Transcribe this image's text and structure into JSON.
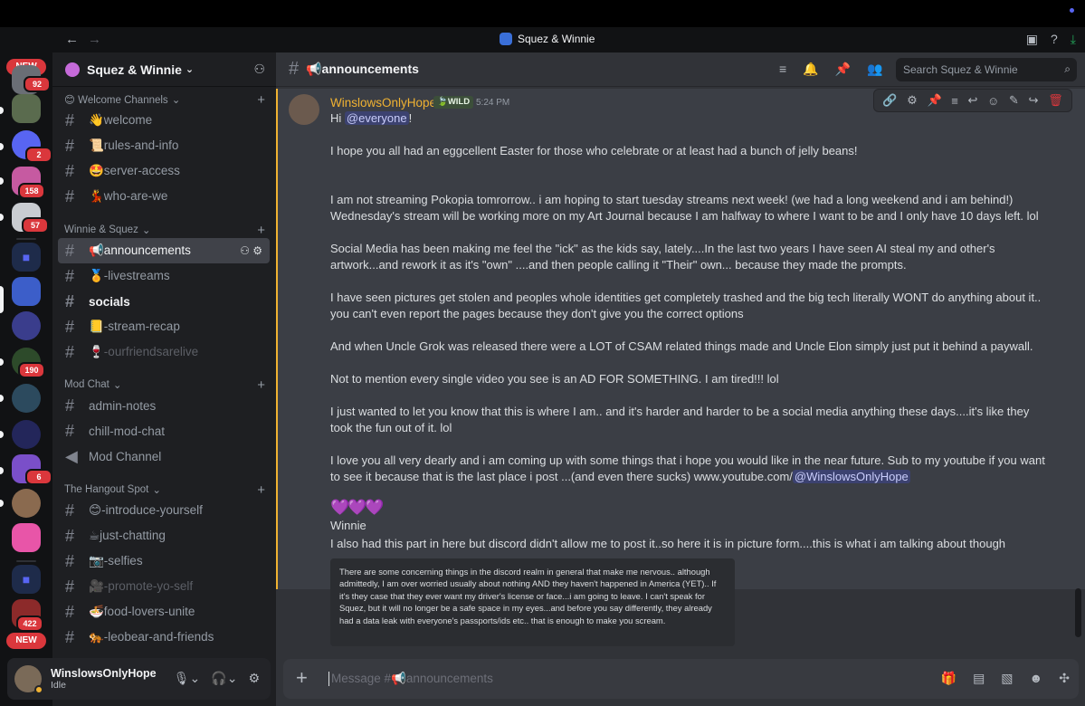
{
  "window": {
    "title": "Squez & Winnie",
    "back": "←",
    "forward": "→",
    "right_icons": [
      "inbox-icon",
      "help-icon",
      "download-icon"
    ]
  },
  "rail": {
    "new_label": "NEW",
    "badges": [
      "92",
      "2",
      "158",
      "57",
      "190",
      "6",
      "422"
    ]
  },
  "server": {
    "name": "Squez & Winnie",
    "caret": "⌄",
    "categories": [
      {
        "name": "😊 Welcome Channels",
        "channels": [
          "👋welcome",
          "📜rules-and-info",
          "🤩server-access",
          "💃who-are-we"
        ]
      },
      {
        "name": "Winnie & Squez",
        "channels": [
          "📢announcements",
          "🏅-livestreams",
          "socials",
          "📒-stream-recap",
          "🍷-ourfriendsarelive"
        ]
      },
      {
        "name": "Mod Chat",
        "channels": [
          "admin-notes",
          "chill-mod-chat",
          "Mod Channel"
        ]
      },
      {
        "name": "The Hangout Spot",
        "channels": [
          "😊-introduce-yourself",
          "☕just-chatting",
          "📷-selfies",
          "🎥-promote-yo-self",
          "🍜food-lovers-unite",
          "🐅-leobear-and-friends"
        ]
      }
    ]
  },
  "user": {
    "name": "WinslowsOnlyHope",
    "status": "Idle"
  },
  "channel": {
    "name": "📢announcements",
    "search_placeholder": "Search Squez & Winnie"
  },
  "message": {
    "author": "WinslowsOnlyHope",
    "tag": "🍃WILD",
    "time": "5:24 PM",
    "greeting_pre": "Hi ",
    "greeting_mention": "@everyone",
    "greeting_post": "!",
    "p1": "I hope you all had an eggcellent Easter for those who celebrate or at least had a bunch of jelly beans!",
    "p2": " I am not streaming Pokopia tomrorrow.. i am hoping to start tuesday streams next week! (we had a long weekend and i am behind!) Wednesday's stream will be working more on my Art Journal because I am halfway to where I want to be and I only have 10 days left. lol",
    "p3": "Social Media has been making me feel the \"ick\" as the kids say, lately....In the last two years I have seen AI steal my and other's artwork...and rework it as it's \"own\" ....and then people calling it \"Their\" own... because they made the prompts.",
    "p4": "I have seen pictures get stolen and peoples whole identities get completely trashed and the big tech literally WONT do anything about it.. you can't even report the pages because they don't give you the correct options",
    "p5": "And when Uncle Grok was released there were a LOT of CSAM related things made and Uncle Elon simply just put it behind a paywall.",
    "p6": "Not to mention every single video you see is an AD FOR SOMETHING. I am tired!!! lol",
    "p7": "I just wanted to let you know that this is where I am.. and it's harder and harder to be a social media anything these days....it's like they took the fun out of it. lol",
    "p8_pre": "I love you all very dearly and i am coming up with some things that i hope you would like in the near future. Sub to my youtube if you want to see it because that is the last place i post ...(and even there sucks) www.youtube.com/",
    "p8_mention": "@WinslowsOnlyHope",
    "hearts": "💜💜💜",
    "signoff": "Winnie",
    "p9": "I also had this part in here but discord didn't allow me to post it..so here it is in picture form....this is what i am talking about though",
    "image_text": "There are some concerning things in the discord realm in general that make me nervous.. although admittedly, I am over worried usually about nothing AND they haven't happened in America (YET).. If it's they case that they ever want my driver's license or face...i am going to leave. I can't speak for Squez, but it will no longer be a safe space in my eyes...and before you say differently, they already had a data leak with everyone's passports/ids etc.. that is enough to make you scream."
  },
  "composer": {
    "placeholder": "Message #📢announcements",
    "plus": "+"
  },
  "colors": {
    "accent": "#5865f2",
    "idle": "#f0b232",
    "danger": "#da373c",
    "background": "#313338"
  }
}
